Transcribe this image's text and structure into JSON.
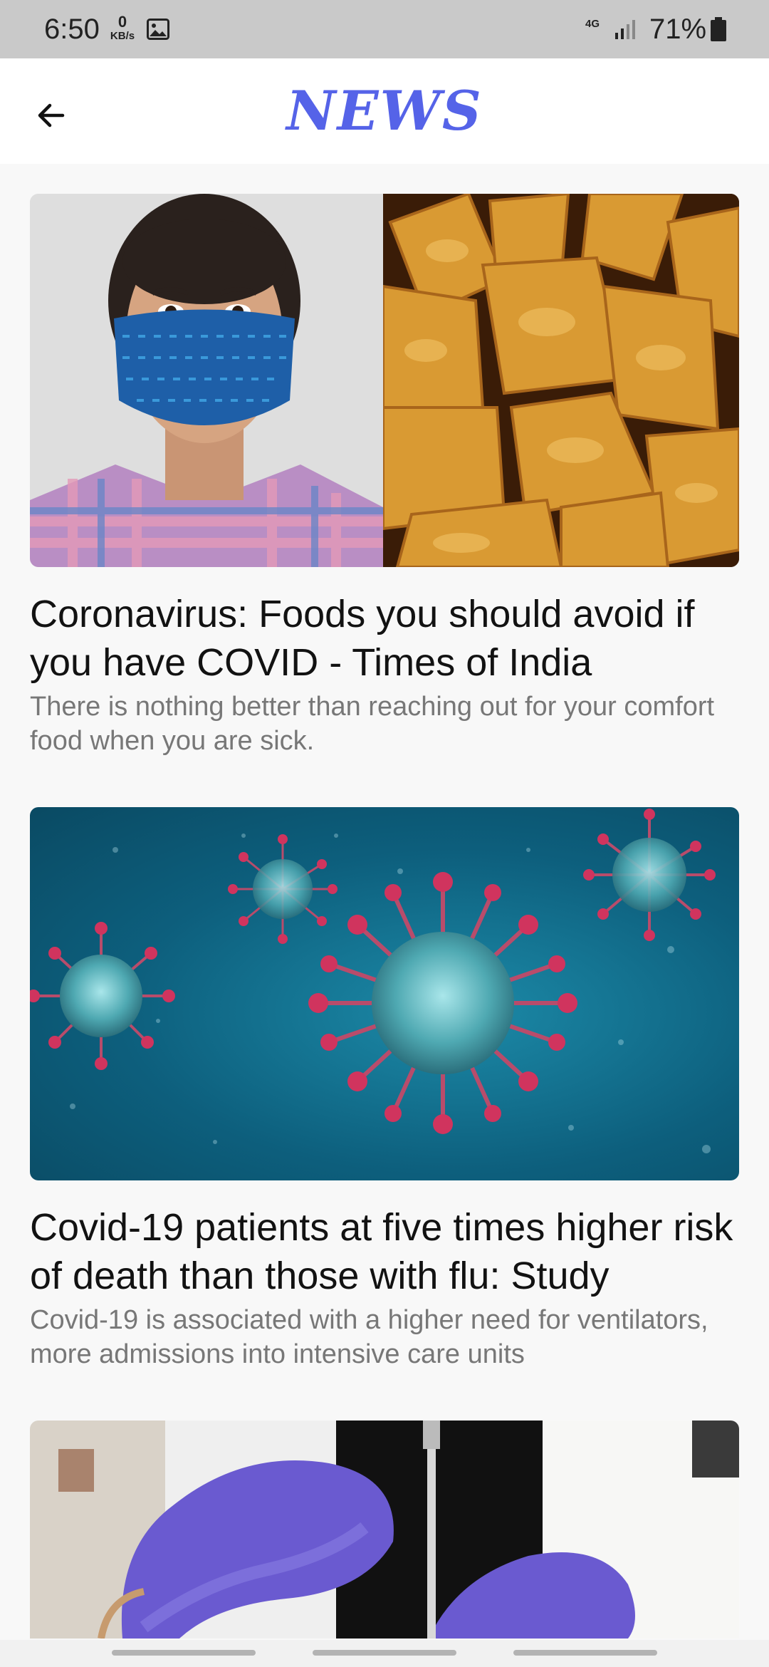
{
  "status_bar": {
    "time": "6:50",
    "data_speed_value": "0",
    "data_speed_unit": "KB/s",
    "network": "4G",
    "battery_percent": "71%"
  },
  "app_bar": {
    "title": "NEWS",
    "back_icon": "arrow-left-icon"
  },
  "articles": [
    {
      "title": "Coronavirus: Foods you should avoid if you have COVID - Times of India",
      "description": "There is nothing better than reaching out for your comfort food when you are sick."
    },
    {
      "title": "Covid-19 patients at five times higher risk of death than those with flu: Study",
      "description": "Covid-19 is associated with a higher need for ventilators, more admissions into intensive care units"
    },
    {
      "title": "",
      "description": ""
    }
  ],
  "colors": {
    "title_accent": "#5563e8",
    "status_bar_bg": "#c9c9c9",
    "page_bg": "#f8f8f8"
  }
}
